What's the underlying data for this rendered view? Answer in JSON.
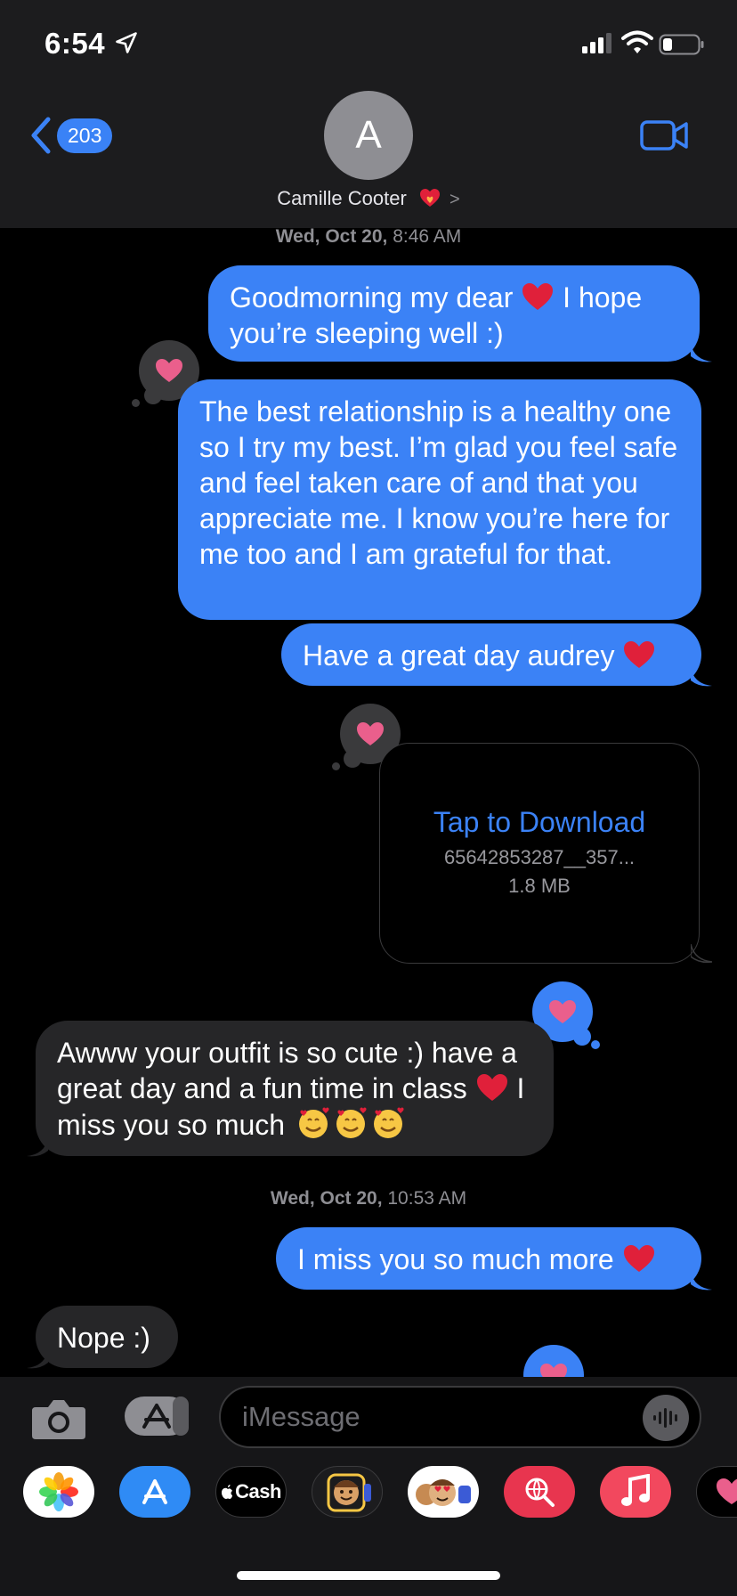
{
  "status_bar": {
    "time": "6:54"
  },
  "header": {
    "back_count": "203",
    "avatar_initial": "A",
    "contact_name": "Camille Cooter",
    "chevron": ">"
  },
  "timestamps": [
    {
      "day": "Wed, Oct 20,",
      "time": "8:46 AM"
    },
    {
      "day": "Wed, Oct 20,",
      "time": "10:53 AM"
    }
  ],
  "messages": {
    "m1": {
      "text_a": "Goodmorning my dear",
      "text_b": "I hope you’re sleeping well :)"
    },
    "m2": {
      "text": "The best relationship is a healthy one so I try my best. I’m glad you feel safe and feel taken care of and that you appreciate me. I know you’re here for me too and I am grateful for that."
    },
    "m3": {
      "text": "Have a great day audrey"
    },
    "attachment": {
      "action": "Tap to Download",
      "filename": "65642853287__357...",
      "size": "1.8 MB"
    },
    "m4": {
      "text_a": "Awww your outfit is so cute :) have a great day and a fun time in class",
      "text_b": "I miss you so much"
    },
    "m5": {
      "text": "I miss you so much more"
    },
    "m6": {
      "text": "Nope :)"
    }
  },
  "input_bar": {
    "placeholder": "iMessage"
  },
  "app_drawer": {
    "items": [
      "photos-app",
      "app-store",
      "apple-cash",
      "memoji-stickers",
      "animoji",
      "image-search",
      "music",
      "digital-touch"
    ],
    "cash_label": "Cash"
  },
  "colors": {
    "accent_blue": "#3b82f6",
    "incoming_bubble": "#262628",
    "header_bg": "#1c1c1e",
    "heart_red": "#e0203a",
    "tapback_heart": "#ea5f8c"
  }
}
